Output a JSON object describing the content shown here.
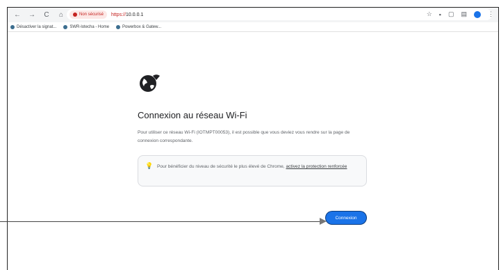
{
  "browser": {
    "nav": {
      "back_glyph": "←",
      "forward_glyph": "→",
      "reload_glyph": "C",
      "home_glyph": "⌂"
    },
    "security_label": "Non sécurisé",
    "url_scheme": "https://",
    "url_host": "10.0.0.1",
    "icons": {
      "star": "☆",
      "extension": "▪",
      "sidebar": "▢",
      "split": "▤",
      "menu": "⋮"
    }
  },
  "bookmarks": [
    {
      "label": "Désactiver la signat..."
    },
    {
      "label": "SWR-lotecha - Home"
    },
    {
      "label": "Powerbox & Gatew..."
    }
  ],
  "page": {
    "title": "Connexion au réseau Wi-Fi",
    "description": "Pour utiliser ce réseau Wi-Fi (IOTMPT00053), il est possible que vous deviez vous rendre sur la page de connexion correspondante.",
    "tip_text": "Pour bénéficier du niveau de sécurité le plus élevé de Chrome, ",
    "tip_link": "activez la protection renforcée",
    "connect_button": "Connexion"
  },
  "colors": {
    "accent": "#1a73e8",
    "danger": "#c5221f"
  }
}
